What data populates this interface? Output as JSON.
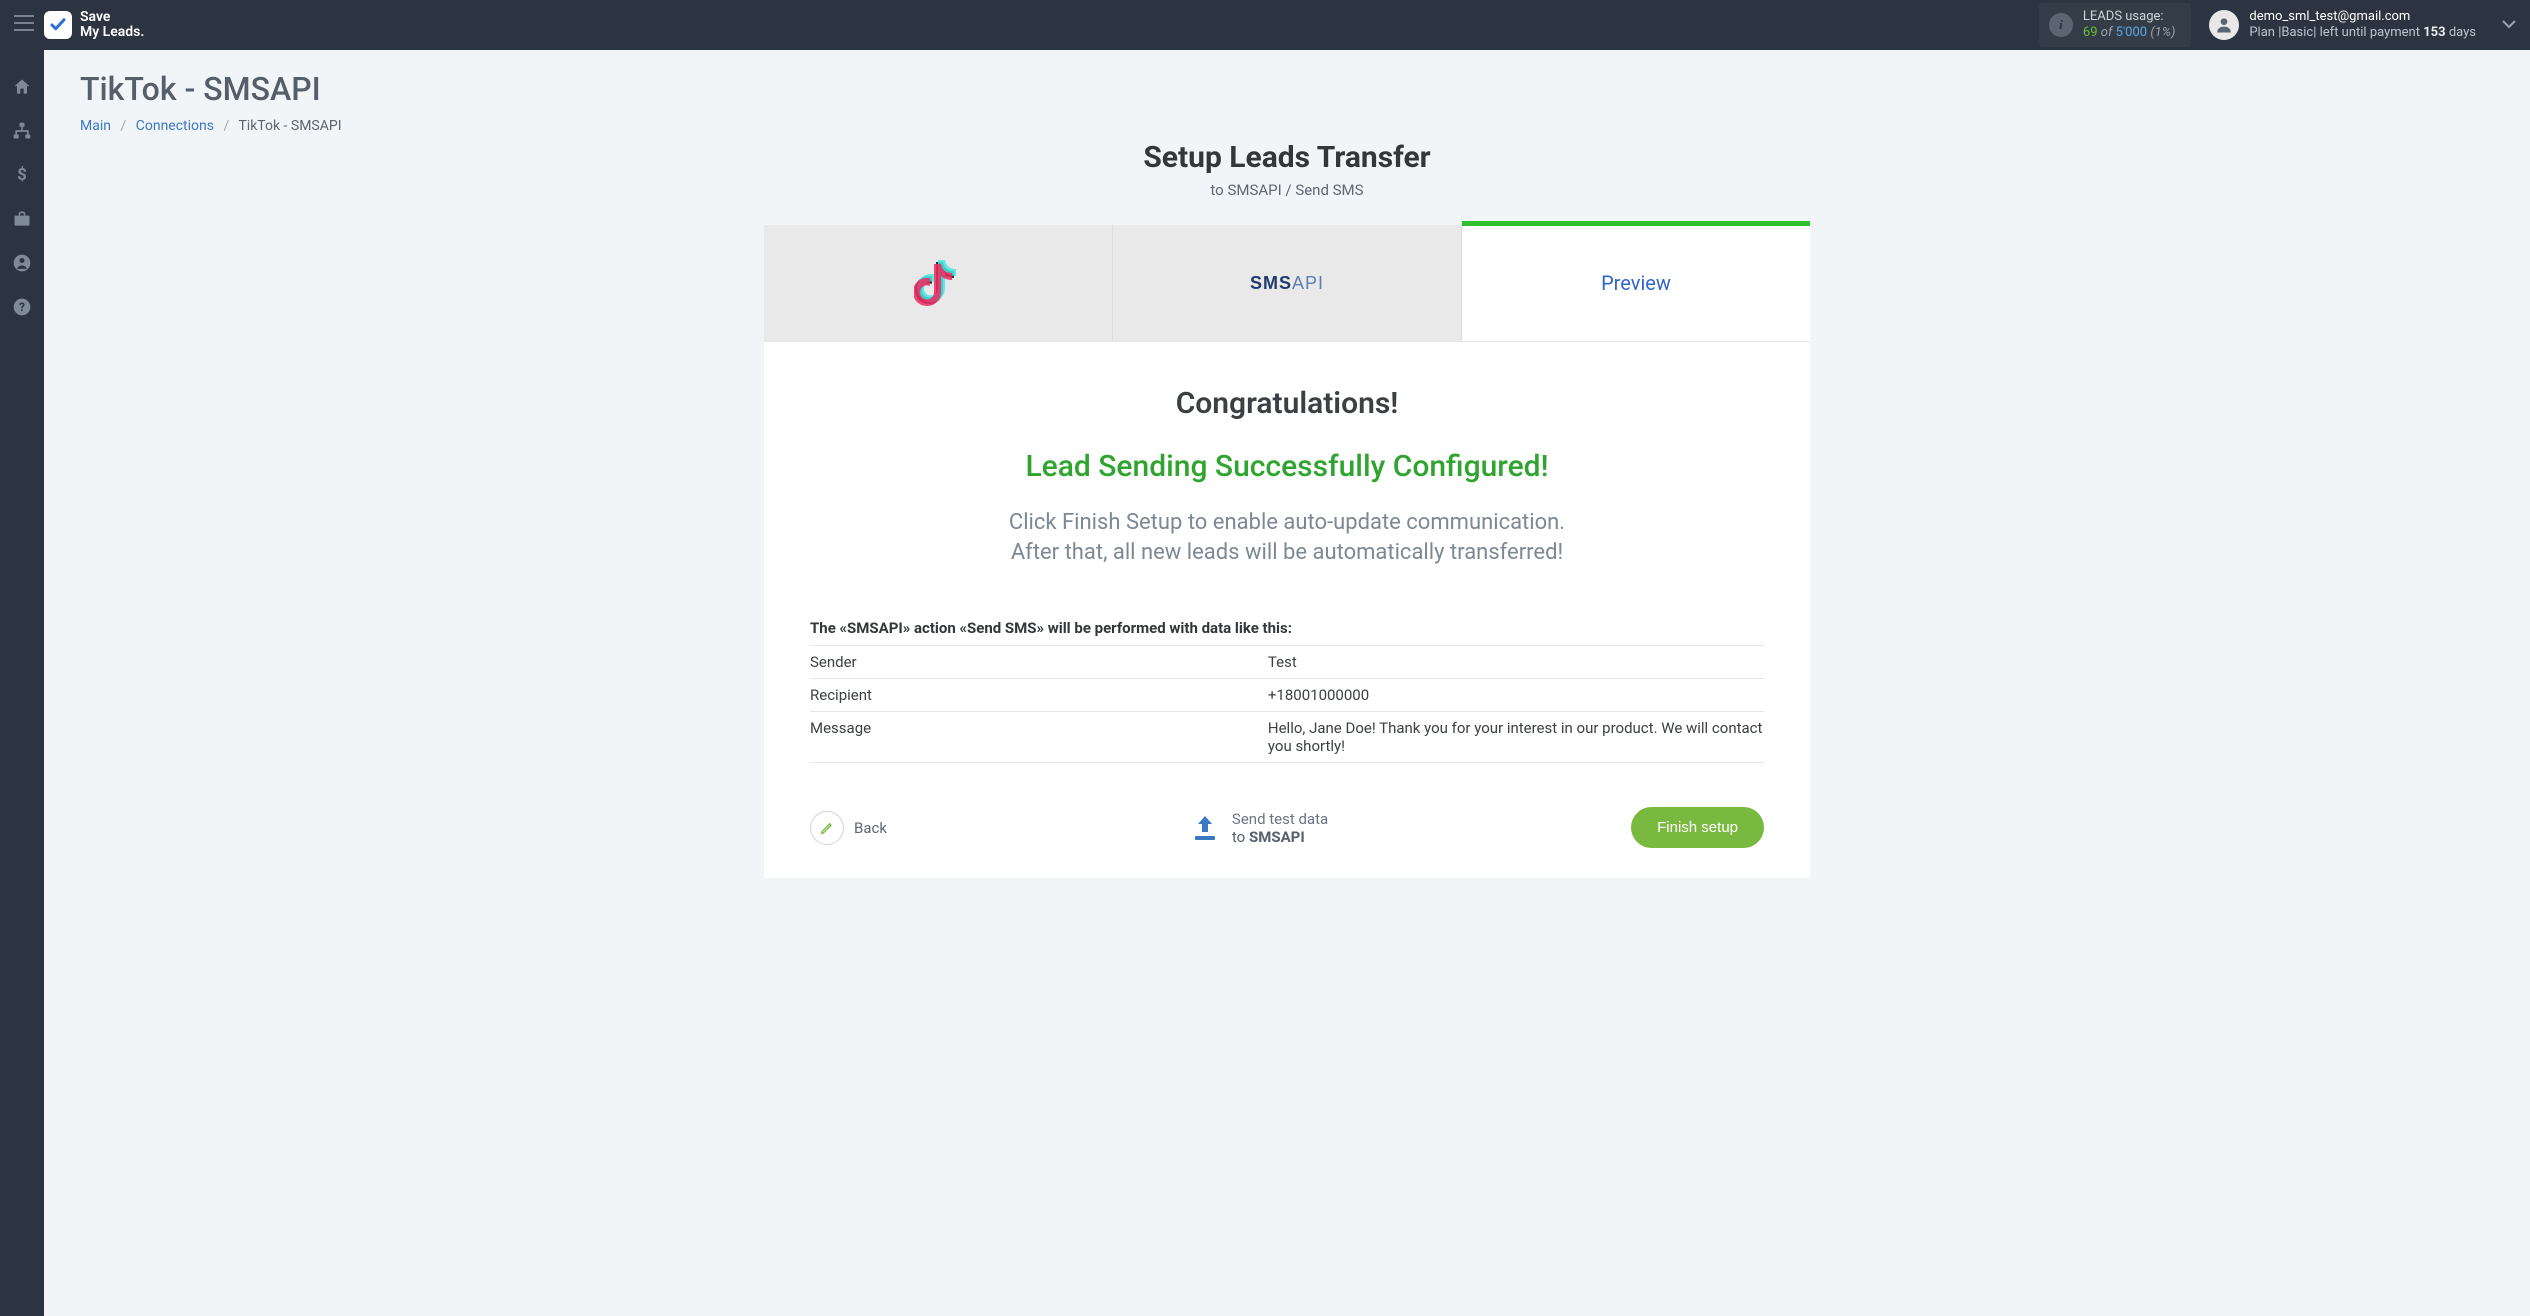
{
  "brand": {
    "line1": "Save",
    "line2": "My Leads."
  },
  "usage": {
    "title": "LEADS usage:",
    "used": "69",
    "of": "of",
    "total": "5'000",
    "pct": "(1%)"
  },
  "user": {
    "email": "demo_sml_test@gmail.com",
    "plan_prefix": "Plan |Basic| left until payment ",
    "plan_days": "153",
    "plan_suffix": " days"
  },
  "page": {
    "title": "TikTok - SMSAPI"
  },
  "breadcrumbs": {
    "main": "Main",
    "connections": "Connections",
    "current": "TikTok - SMSAPI"
  },
  "headline": {
    "title": "Setup Leads Transfer",
    "subtitle": "to SMSAPI / Send SMS"
  },
  "tabs": {
    "preview": "Preview"
  },
  "congrats": {
    "title": "Congratulations!",
    "success": "Lead Sending Successfully Configured!",
    "hint_l1": "Click Finish Setup to enable auto-update communication.",
    "hint_l2": "After that, all new leads will be automatically transferred!"
  },
  "preview": {
    "note": "The «SMSAPI» action «Send SMS» will be performed with data like this:",
    "rows": [
      {
        "field": "Sender",
        "value": "Test"
      },
      {
        "field": "Recipient",
        "value": "+18001000000"
      },
      {
        "field": "Message",
        "value": "Hello, Jane Doe! Thank you for your interest in our product. We will contact you shortly!"
      }
    ]
  },
  "actions": {
    "back": "Back",
    "send_test_l1": "Send test data",
    "send_test_l2_prefix": "to ",
    "send_test_l2_bold": "SMSAPI",
    "finish": "Finish setup"
  }
}
